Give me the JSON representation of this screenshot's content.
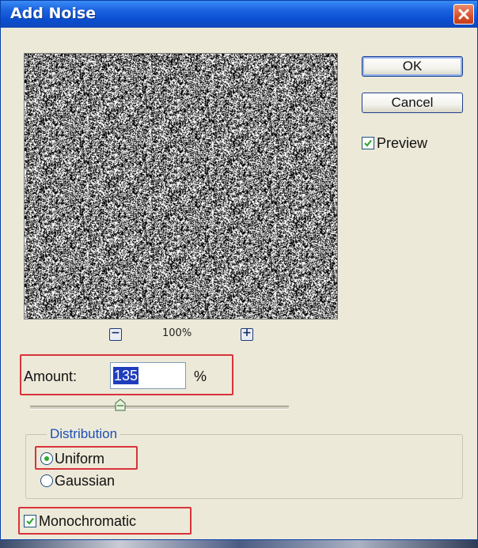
{
  "dialog": {
    "title": "Add Noise",
    "close_icon": "close-icon"
  },
  "buttons": {
    "ok_label": "OK",
    "cancel_label": "Cancel"
  },
  "preview": {
    "label": "Preview",
    "checked": true,
    "zoom": "100%",
    "zoom_out_symbol": "−",
    "zoom_in_symbol": "+"
  },
  "amount": {
    "label": "Amount:",
    "value": "135",
    "unit": "%",
    "slider_fraction": 0.34
  },
  "distribution": {
    "title": "Distribution",
    "options": [
      {
        "label": "Uniform",
        "selected": true
      },
      {
        "label": "Gaussian",
        "selected": false
      }
    ]
  },
  "monochromatic": {
    "label": "Monochromatic",
    "checked": true
  },
  "colors": {
    "titlebar": "#0a4fd2",
    "dialog_bg": "#ece9d8",
    "highlight_box": "#d9333a",
    "check_mark": "#2da832",
    "group_title": "#1c4fb6"
  }
}
